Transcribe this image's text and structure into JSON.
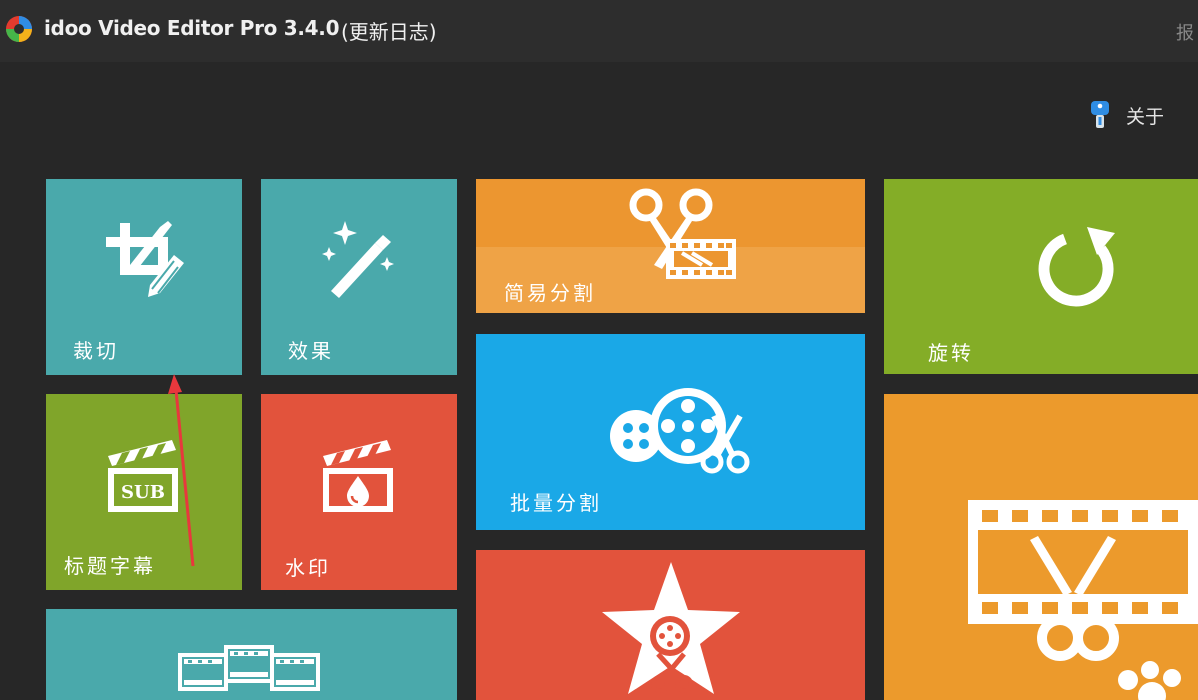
{
  "titlebar": {
    "app_title": "idoo Video Editor Pro 3.4.0",
    "changelog_link": "(更新日志)",
    "right_edge_text": "报"
  },
  "header": {
    "about_label": "关于"
  },
  "tiles": {
    "crop": "裁切",
    "effect": "效果",
    "simple_split": "简易分割",
    "rotate": "旋转",
    "subtitle": "标题字幕",
    "watermark": "水印",
    "batch_split": "批量分割"
  },
  "icons": {
    "app": "app-logo-icon",
    "about": "info-icon",
    "crop": "crop-edit-icon",
    "effect": "magic-wand-icon",
    "simple_split": "scissors-film-icon",
    "rotate": "rotate-icon",
    "subtitle": "clapperboard-sub-icon",
    "watermark": "clapperboard-drop-icon",
    "batch_split": "film-reels-scissors-icon",
    "bottom_left": "film-strips-icon",
    "bottom_mid": "star-reel-scissors-icon",
    "bottom_right": "film-frame-scissors-icon"
  },
  "icon_glyphs": {
    "subtitle_badge": "SUB"
  },
  "colors": {
    "teal": "#4aa9ab",
    "orange": "#ec9630",
    "green": "#84ad27",
    "red": "#e2533c",
    "blue": "#1aa8e7",
    "annotation_arrow": "#e8383d"
  }
}
